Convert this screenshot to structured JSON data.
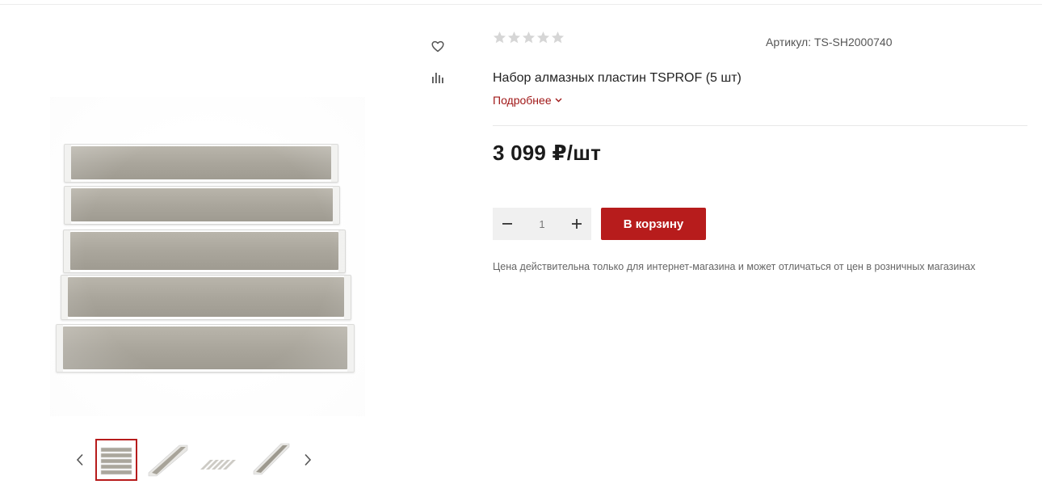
{
  "product": {
    "title": "Набор алмазных пластин TSPROF (5 шт)",
    "sku_label": "Артикул: TS-SH2000740",
    "rating": 0,
    "rating_max": 5,
    "more_link": "Подробнее",
    "price": "3 099 ₽/шт",
    "quantity": "1",
    "add_to_cart": "В корзину",
    "price_note": "Цена действительна только для интернет-магазина и может отличаться от цен в розничных магазинах"
  },
  "gallery": {
    "thumbnails_count": 4,
    "active_index": 0
  },
  "colors": {
    "accent": "#b71c1c",
    "link": "#a01818",
    "star_empty": "#d6d6d6",
    "qty_bg": "#f0f0f0"
  },
  "icons": {
    "favorite": "heart-icon",
    "compare": "bar-chart-icon",
    "prev": "chevron-left-icon",
    "next": "chevron-right-icon",
    "minus": "minus-icon",
    "plus": "plus-icon",
    "more": "chevron-down-icon"
  }
}
